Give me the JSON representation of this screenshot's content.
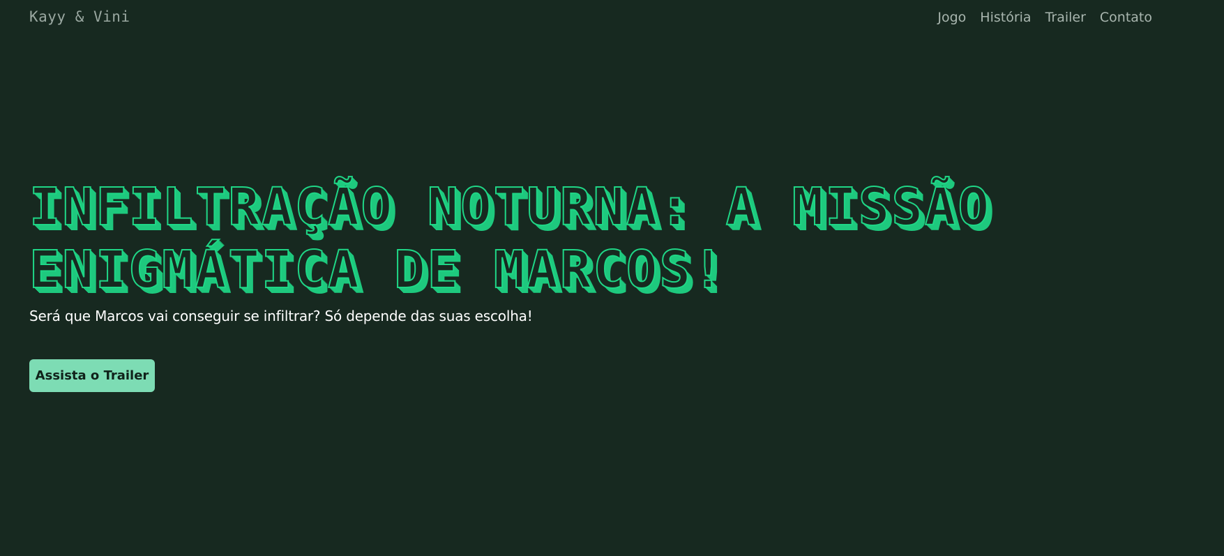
{
  "header": {
    "brand": "Kayy & Vini",
    "nav": [
      {
        "label": "Jogo"
      },
      {
        "label": "História"
      },
      {
        "label": "Trailer"
      },
      {
        "label": "Contato"
      }
    ]
  },
  "hero": {
    "title": "INFILTRAÇÃO NOTURNA: A MISSÃO ENIGMÁTICA DE MARCOS!",
    "subtitle": "Será que Marcos vai conseguir se infiltrar? Só depende das suas escolha!",
    "cta_label": "Assista o Trailer"
  },
  "colors": {
    "background": "#172920",
    "accent": "#1fd686",
    "button": "#7ddcb4"
  }
}
